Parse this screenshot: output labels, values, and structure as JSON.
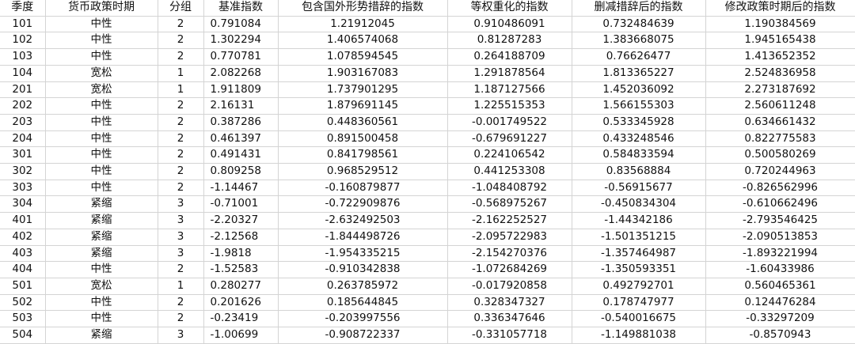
{
  "table": {
    "headers": [
      "季度",
      "货币政策时期",
      "分组",
      "基准指数",
      "包含国外形势措辞的指数",
      "等权重化的指数",
      "删减措辞后的指数",
      "修改政策时期后的指数"
    ],
    "rows": [
      [
        "101",
        "中性",
        "2",
        "0.791084",
        "1.21912045",
        "0.910486091",
        "0.732484639",
        "1.190384569"
      ],
      [
        "102",
        "中性",
        "2",
        "1.302294",
        "1.406574068",
        "0.81287283",
        "1.383668075",
        "1.945165438"
      ],
      [
        "103",
        "中性",
        "2",
        "0.770781",
        "1.078594545",
        "0.264188709",
        "0.76626477",
        "1.413652352"
      ],
      [
        "104",
        "宽松",
        "1",
        "2.082268",
        "1.903167083",
        "1.291878564",
        "1.813365227",
        "2.524836958"
      ],
      [
        "201",
        "宽松",
        "1",
        "1.911809",
        "1.737901295",
        "1.187127566",
        "1.452036092",
        "2.273187692"
      ],
      [
        "202",
        "中性",
        "2",
        "2.16131",
        "1.879691145",
        "1.225515353",
        "1.566155303",
        "2.560611248"
      ],
      [
        "203",
        "中性",
        "2",
        "0.387286",
        "0.448360561",
        "-0.001749522",
        "0.533345928",
        "0.634661432"
      ],
      [
        "204",
        "中性",
        "2",
        "0.461397",
        "0.891500458",
        "-0.679691227",
        "0.433248546",
        "0.822775583"
      ],
      [
        "301",
        "中性",
        "2",
        "0.491431",
        "0.841798561",
        "0.224106542",
        "0.584833594",
        "0.500580269"
      ],
      [
        "302",
        "中性",
        "2",
        "0.809258",
        "0.968529512",
        "0.441253308",
        "0.83568884",
        "0.720244963"
      ],
      [
        "303",
        "中性",
        "2",
        "-1.14467",
        "-0.160879877",
        "-1.048408792",
        "-0.56915677",
        "-0.826562996"
      ],
      [
        "304",
        "紧缩",
        "3",
        "-0.71001",
        "-0.722909876",
        "-0.568975267",
        "-0.450834304",
        "-0.610662496"
      ],
      [
        "401",
        "紧缩",
        "3",
        "-2.20327",
        "-2.632492503",
        "-2.162252527",
        "-1.44342186",
        "-2.793546425"
      ],
      [
        "402",
        "紧缩",
        "3",
        "-2.12568",
        "-1.844498726",
        "-2.095722983",
        "-1.501351215",
        "-2.090513853"
      ],
      [
        "403",
        "紧缩",
        "3",
        "-1.9818",
        "-1.954335215",
        "-2.154270376",
        "-1.357464987",
        "-1.893221994"
      ],
      [
        "404",
        "中性",
        "2",
        "-1.52583",
        "-0.910342838",
        "-1.072684269",
        "-1.350593351",
        "-1.60433986"
      ],
      [
        "501",
        "宽松",
        "1",
        "0.280277",
        "0.263785972",
        "-0.017920858",
        "0.492792701",
        "0.560465361"
      ],
      [
        "502",
        "中性",
        "2",
        "0.201626",
        "0.185644845",
        "0.328347327",
        "0.178747977",
        "0.124476284"
      ],
      [
        "503",
        "中性",
        "2",
        "-0.23419",
        "-0.203997556",
        "0.336347646",
        "-0.540016675",
        "-0.33297209"
      ],
      [
        "504",
        "紧缩",
        "3",
        "-1.00699",
        "-0.908722337",
        "-0.331057718",
        "-1.149881038",
        "-0.8570943"
      ]
    ]
  }
}
